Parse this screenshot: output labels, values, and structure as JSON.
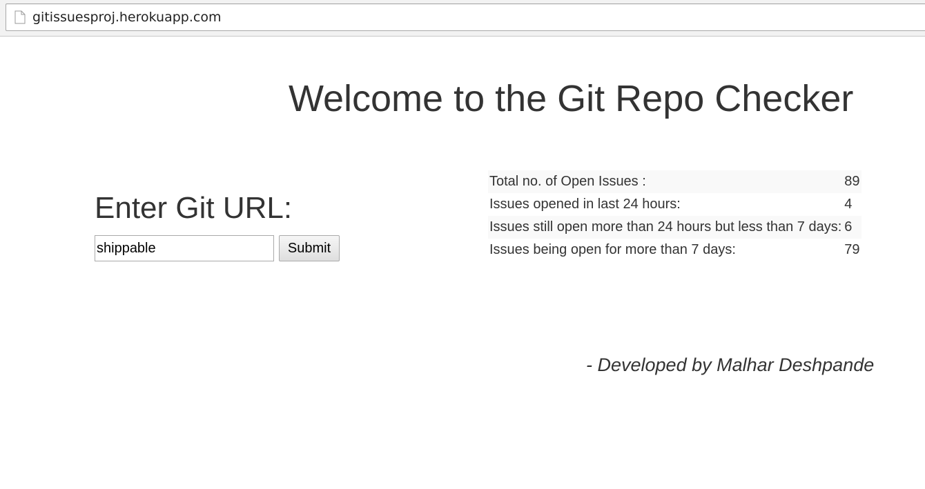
{
  "browser": {
    "url": "gitissuesproj.herokuapp.com",
    "page_icon": "document-icon"
  },
  "header": {
    "title": "Welcome to the Git Repo Checker"
  },
  "form": {
    "label": "Enter Git URL:",
    "input_value": "shippable",
    "submit_label": "Submit"
  },
  "stats": {
    "rows": [
      {
        "label": "Total no. of Open Issues :",
        "value": "89"
      },
      {
        "label": "Issues opened in last 24 hours:",
        "value": "4"
      },
      {
        "label": "Issues still open more than 24 hours but less than 7 days:",
        "value": "6"
      },
      {
        "label": "Issues being open for more than 7 days:",
        "value": "79"
      }
    ]
  },
  "footer": {
    "credit": "- Developed by Malhar Deshpande"
  },
  "colors": {
    "text": "#333333",
    "stripe": "#f9f9f9",
    "chrome": "#f2f2f2"
  }
}
